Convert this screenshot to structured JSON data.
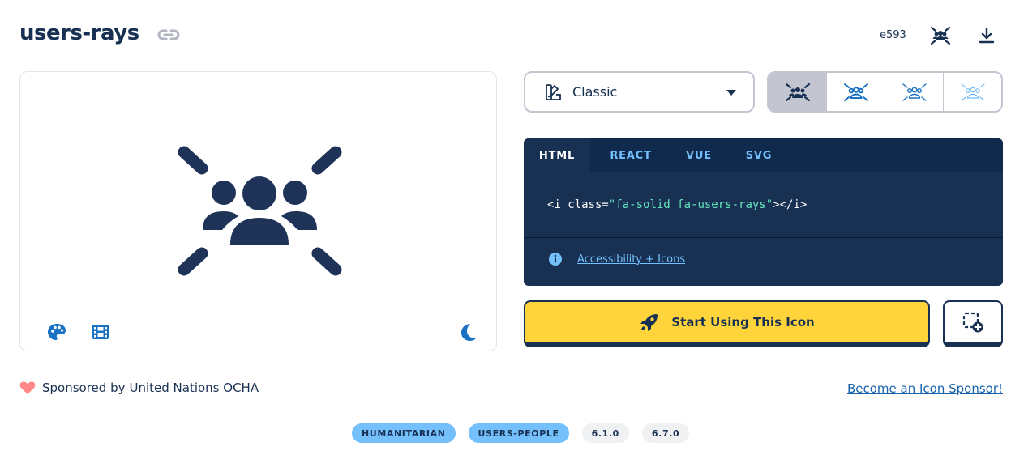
{
  "header": {
    "title": "users-rays",
    "unicode": "e593"
  },
  "style_selector": {
    "label": "Classic"
  },
  "code": {
    "tabs": [
      {
        "label": "HTML",
        "active": true
      },
      {
        "label": "REACT",
        "active": false
      },
      {
        "label": "VUE",
        "active": false
      },
      {
        "label": "SVG",
        "active": false
      }
    ],
    "open": "<i class=",
    "quote": "\"",
    "class_value": "fa-solid fa-users-rays",
    "close": "></i>",
    "accessibility_link": "Accessibility + Icons"
  },
  "cta": {
    "label": "Start Using This Icon"
  },
  "sponsor": {
    "prefix": "Sponsored by",
    "name": "United Nations OCHA",
    "become": "Become an Icon Sponsor!"
  },
  "tags": {
    "categories": [
      "HUMANITARIAN",
      "USERS-PEOPLE"
    ],
    "versions": [
      "6.1.0",
      "6.7.0"
    ]
  },
  "icons": {
    "link": "link-icon",
    "header_rays": "users-rays-icon",
    "download": "download-icon",
    "palette": "palette-icon",
    "film": "film-icon",
    "moon": "moon-icon",
    "style": "style-swatch-icon",
    "caret": "caret-down-icon",
    "info": "info-circle-icon",
    "rocket": "rocket-icon",
    "add": "square-plus-icon",
    "heart": "heart-icon"
  },
  "colors": {
    "navy": "#183153",
    "yellow": "#ffd43b",
    "light_blue": "#74c0fc",
    "link_blue": "#1864ab",
    "mint": "#63e6be",
    "heart": "#ff8787",
    "tool_blue": "#1971c2"
  }
}
